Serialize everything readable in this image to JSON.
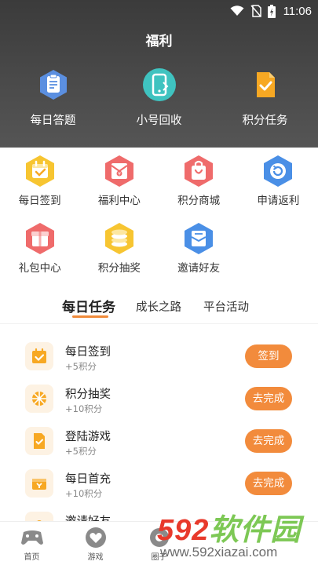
{
  "status_bar": {
    "time": "11:06"
  },
  "header": {
    "title": "福利",
    "actions": [
      {
        "label": "每日答题",
        "icon": "quiz-icon"
      },
      {
        "label": "小号回收",
        "icon": "phone-recycle-icon"
      },
      {
        "label": "积分任务",
        "icon": "task-icon"
      }
    ]
  },
  "grid": {
    "items": [
      {
        "label": "每日签到",
        "icon": "calendar-check-icon",
        "color": "#f7c531"
      },
      {
        "label": "福利中心",
        "icon": "welfare-envelope-icon",
        "color": "#ef6b6b"
      },
      {
        "label": "积分商城",
        "icon": "mall-bag-icon",
        "color": "#ef6b6b"
      },
      {
        "label": "申请返利",
        "icon": "refund-cycle-icon",
        "color": "#4a8fe6"
      },
      {
        "label": "礼包中心",
        "icon": "gift-box-icon",
        "color": "#ef6b6b"
      },
      {
        "label": "积分抽奖",
        "icon": "coin-stack-icon",
        "color": "#f7c531"
      },
      {
        "label": "邀请好友",
        "icon": "invite-letter-icon",
        "color": "#4a8fe6"
      }
    ]
  },
  "tabs": [
    {
      "label": "每日任务",
      "active": true
    },
    {
      "label": "成长之路",
      "active": false
    },
    {
      "label": "平台活动",
      "active": false
    }
  ],
  "tasks": [
    {
      "name": "每日签到",
      "points": "+5积分",
      "button": "签到",
      "icon": "calendar-check-icon"
    },
    {
      "name": "积分抽奖",
      "points": "+10积分",
      "button": "去完成",
      "icon": "lottery-wheel-icon"
    },
    {
      "name": "登陆游戏",
      "points": "+5积分",
      "button": "去完成",
      "icon": "document-check-icon"
    },
    {
      "name": "每日首充",
      "points": "+10积分",
      "button": "去完成",
      "icon": "recharge-icon"
    },
    {
      "name": "邀请好友",
      "points": "",
      "button": "",
      "icon": "invite-icon"
    }
  ],
  "bottom_nav": [
    {
      "label": "首页",
      "icon": "gamepad-icon"
    },
    {
      "label": "游戏",
      "icon": "heart-game-icon"
    },
    {
      "label": "圈子",
      "icon": "circle-icon"
    },
    {
      "label": "",
      "icon": ""
    },
    {
      "label": "",
      "icon": ""
    }
  ],
  "watermark": {
    "main_num": "592",
    "main_cn": "软件园",
    "sub": "www.592xiazai.com"
  },
  "colors": {
    "accent": "#f28b3c",
    "header_bg": "#444444",
    "icon_bg": "#fdf2e3"
  }
}
